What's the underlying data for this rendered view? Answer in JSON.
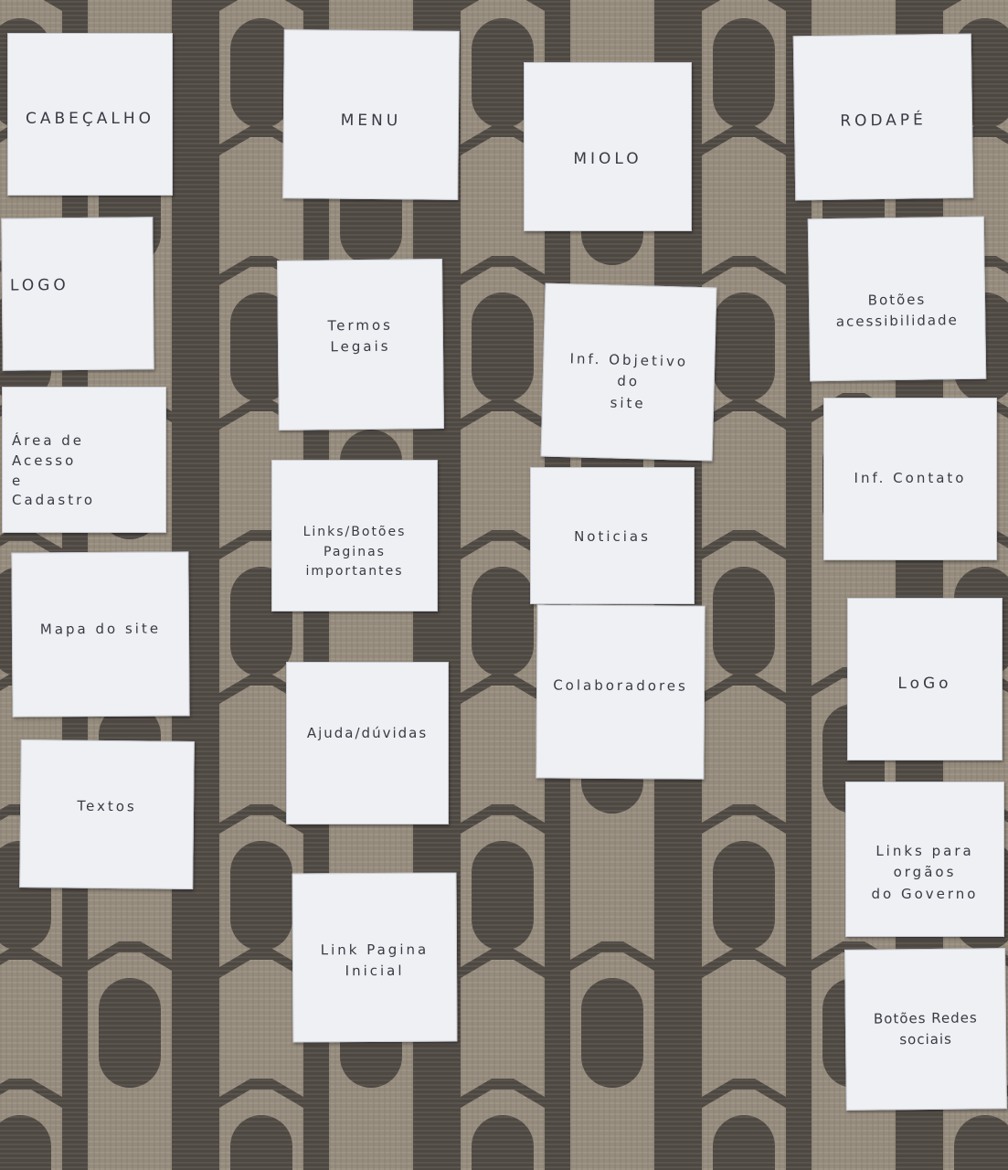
{
  "cards": {
    "cabecalho": "CABEÇALHO",
    "menu": "MENU",
    "miolo": "MIOLO",
    "rodape": "RODAPÉ",
    "logo_top": "LOGO",
    "termos_legais": "Termos\nLegais",
    "inf_objetivo": "Inf. Objetivo\ndo\nsite",
    "botoes_acessibilidade": "Botões\nacessibilidade",
    "area_acesso": "Área de\nAcesso\ne\nCadastro",
    "links_botoes": "Links/Botões\nPaginas\nimportantes",
    "noticias": "Noticias",
    "inf_contato": "Inf. Contato",
    "mapa_site": "Mapa do site",
    "colaboradores": "Colaboradores",
    "logo_footer": "LoGo",
    "ajuda_duvidas": "Ajuda/dúvidas",
    "textos": "Textos",
    "links_orgaos": "Links para\norgãos\ndo Governo",
    "link_pagina_inicial": "Link Pagina\nInicial",
    "botoes_redes": "Botões Redes\nsociais"
  },
  "colors": {
    "fabric_light": "#a59c8b",
    "fabric_dark": "#4f4b47",
    "card": "#eef0f4",
    "ink": "#3a3a44"
  }
}
